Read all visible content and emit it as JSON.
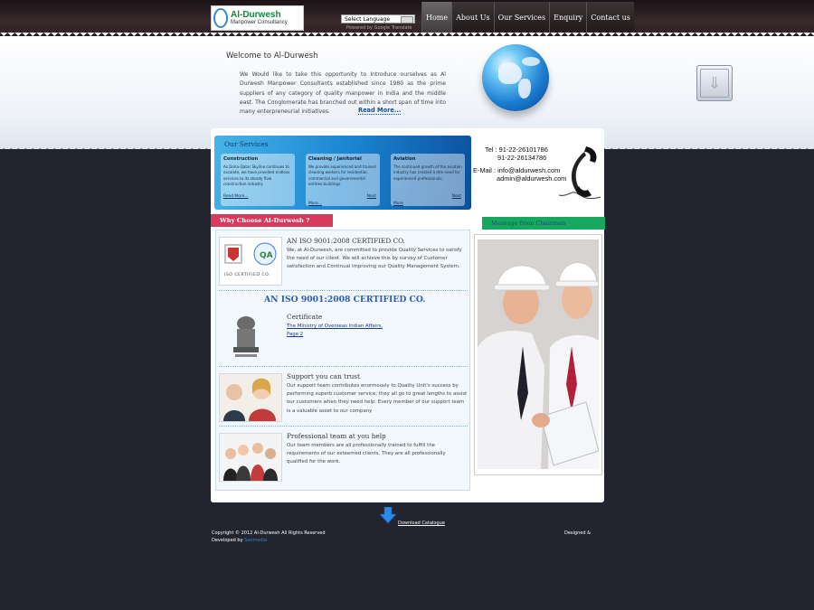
{
  "header": {
    "logo_title": "Al-Durwesh",
    "logo_subtitle": "Manpower Consultancy",
    "language_select": "Select Language",
    "powered_by": "Powered by Google Translate",
    "nav": [
      {
        "label": "Home",
        "active": true
      },
      {
        "label": "About Us",
        "active": false
      },
      {
        "label": "Our Services",
        "active": false
      },
      {
        "label": "Enquiry",
        "active": false
      },
      {
        "label": "Contact us",
        "active": false
      }
    ]
  },
  "welcome": {
    "title": "Welcome to Al-Durwesh",
    "text": "We Would like to take this opportunity to Introduce ourselves as Al Durwesh Manpower Consultants established since 1980 as the prime suppliers of any category of quality manpower in India and the middle east. The Conglomerate has branched out within a short span of time into many enterpreneurial initiatives.",
    "read_more": "Read More..."
  },
  "services": {
    "title": "Our Services",
    "items": [
      {
        "title": "Construction",
        "body": "As Doha-Qatar Skyline continues to escalate, we have provided endless services to its steady flow construction industry.",
        "more": "Read More..."
      },
      {
        "title": "Cleaning / Janitorial",
        "body": "We provide experienced and trained cleaning workers for residential, commercial and governmental entities buildings.",
        "more": "More...",
        "next": "Next"
      },
      {
        "title": "Aviation",
        "body": "The continued growth of the aviation industry has created a dire need for experienced professionals.",
        "more": "More",
        "next": "Next"
      }
    ]
  },
  "contact": {
    "tel_label": "Tel : 91-22-26101786",
    "tel_2": "91-22-26134786",
    "email_label": "E-Mail : info@aldurwesh.com",
    "email_2": "admin@aldurwesh.com"
  },
  "why": {
    "title": "Why Choose Al-Durwesh ?",
    "iso": {
      "heading": "AN ISO 9001:2008 CERTIFIED CO.",
      "body": "We, at Al-Durwesh, are committed to provide Quality Services to satisfy the need of our client. We will achieve this by survey of Customer satisfaction and Continual Improving our Quality Management System.",
      "badge": "ISO CERTIFIED CO."
    },
    "banner": "AN ISO 9001:2008 CERTIFIED CO.",
    "certificate": {
      "heading": "Certificate",
      "link1": "The Ministry of Overseas Indian Affairs,",
      "link2": "Page 2"
    },
    "support": {
      "heading": "Support you can trust",
      "body": "Our support team contributes enormously to Quality Unit's success by performing superb customer service; they all go to great lengths to assist our customers when they need help. Every member of our support team is a valuable asset to our company"
    },
    "team": {
      "heading": "Professional team at you help",
      "body": "Our team members are all professionally trained to fulfill the requirements of our esteemed clients. They are all professionally qualified for the work."
    }
  },
  "chairman": {
    "title": "Message from Chairman"
  },
  "footer": {
    "download": "Download Catalogue",
    "copyright": "Copyright © 2012 Al-Durwesh All Rights Reserved",
    "developed_prefix": "Developed by",
    "developer": "Seomedia",
    "designed": "Designed &"
  }
}
